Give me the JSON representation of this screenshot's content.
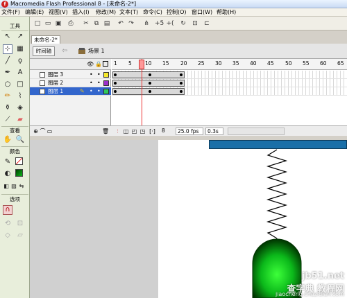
{
  "window": {
    "title": "Macromedia Flash Professional 8 - [未命名-2*]",
    "app_icon": "flash-logo-icon"
  },
  "menu": [
    "文件(F)",
    "编辑(E)",
    "视图(V)",
    "插入(I)",
    "修改(M)",
    "文本(T)",
    "命令(C)",
    "控制(O)",
    "窗口(W)",
    "帮助(H)"
  ],
  "tools": {
    "header": "工具",
    "view_header": "查看",
    "colors_header": "颜色",
    "options_header": "选项"
  },
  "document": {
    "tab": "未命名-2*",
    "timeline_button": "时间轴",
    "scene": "场景 1"
  },
  "timeline": {
    "ruler": [
      "1",
      "5",
      "10",
      "15",
      "20",
      "25",
      "30",
      "35",
      "40",
      "45",
      "50",
      "55",
      "60",
      "65"
    ],
    "layers": [
      {
        "name": "图层 3",
        "color": "#f5e92b",
        "selected": false
      },
      {
        "name": "图层 2",
        "color": "#9b2fc9",
        "selected": false
      },
      {
        "name": "图层 1",
        "color": "#2fc95a",
        "selected": true
      }
    ],
    "current_frame": "8",
    "fps": "25.0 fps",
    "time": "0.3s"
  },
  "colors": {
    "stage_bar": "#1a6fa8",
    "ball": "#0bb81a",
    "selected_layer": "#3366cc"
  },
  "watermark": {
    "line1": "jb51.net",
    "line2": "查字典 教程网",
    "line3": "jiaocheng.chazidian.com"
  }
}
